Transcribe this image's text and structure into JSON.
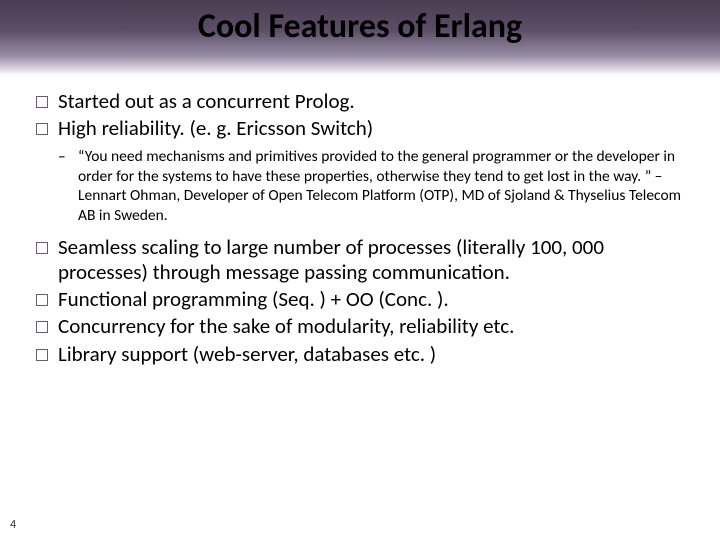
{
  "title": "Cool Features of Erlang",
  "bullets": {
    "b1": "Started out as a concurrent Prolog.",
    "b2": "High reliability. (e. g. Ericsson Switch)",
    "sub1": "“You need mechanisms and primitives provided to the general programmer or the developer in order for the systems to have these properties, otherwise they tend to get lost in the way. ” – Lennart Ohman, Developer of Open Telecom Platform (OTP), MD of Sjoland & Thyselius Telecom AB in Sweden.",
    "b3": "Seamless scaling to large number of processes (literally 100, 000 processes)  through message passing communication.",
    "b4": "Functional programming (Seq. ) + OO (Conc. ).",
    "b5": "Concurrency for the sake of modularity, reliability etc.",
    "b6": "Library support (web-server, databases etc. )"
  },
  "page": "4"
}
